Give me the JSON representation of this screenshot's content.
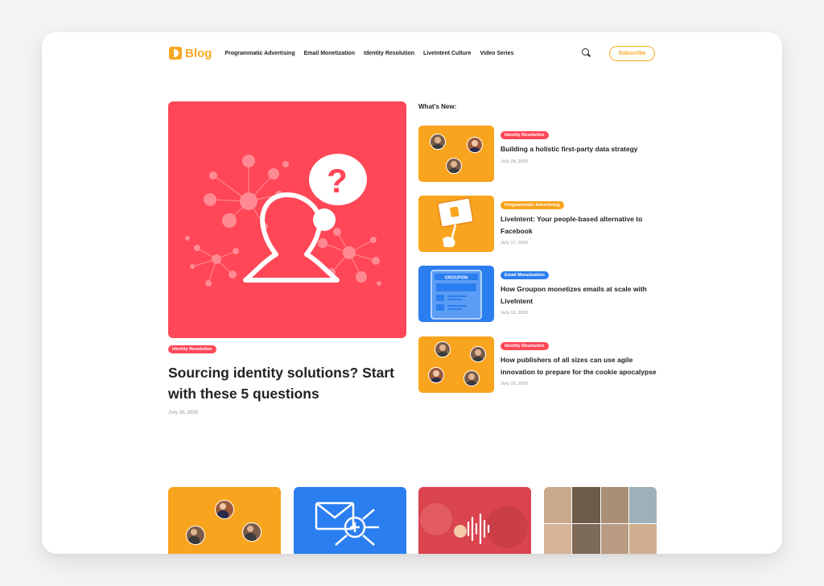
{
  "header": {
    "logo_text": "Blog",
    "nav": [
      "Programmatic Advertising",
      "Email Monetization",
      "Identity Resolution",
      "LiveIntent Culture",
      "Video Series"
    ],
    "subscribe_label": "Subscribe"
  },
  "hero": {
    "tag": "Identity Resolution",
    "title": "Sourcing identity solutions? Start with these 5 questions",
    "date": "July 20, 2020",
    "question_mark": "?"
  },
  "whats_new": {
    "heading": "What's New:",
    "items": [
      {
        "tag": "Identity Resolution",
        "title": "Building a holistic first-party data strategy",
        "date": "July 28, 2020"
      },
      {
        "tag": "Programmatic Advertising",
        "title": "LiveIntent: Your people-based alternative to Facebook",
        "date": "July 17, 2020"
      },
      {
        "tag": "Email Monetization",
        "title": "How Groupon monetizes emails at scale with LiveIntent",
        "date": "July 15, 2020",
        "thumb_text": "GROUPON"
      },
      {
        "tag": "Identity Resolution",
        "title": "How publishers of all sizes can use agile innovation to prepare for the cookie apocalypse",
        "date": "July 15, 2020"
      }
    ]
  },
  "colors": {
    "brand_orange": "#f7a823",
    "identity_red": "#ff4757",
    "email_blue": "#2b7ef0"
  }
}
